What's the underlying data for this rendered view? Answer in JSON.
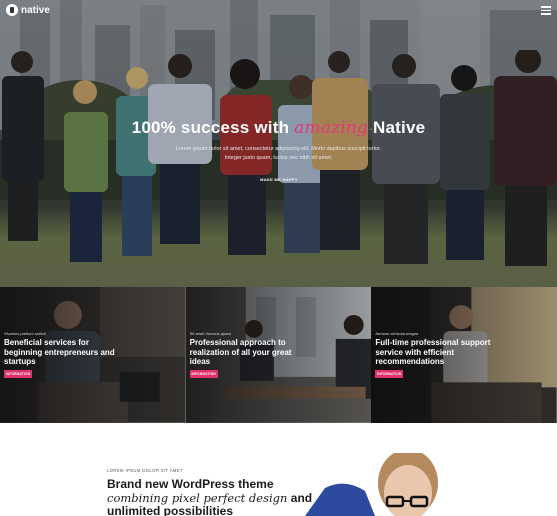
{
  "brand": {
    "logo_text": "native"
  },
  "hero": {
    "title_before": "100% success with",
    "title_accent": "amazing",
    "title_after": "Native",
    "subtitle_line1": "Lorem ipsum dolor sit amet, consectetur adipiscing elit. Morbi dapibus suscipit tortor.",
    "subtitle_line2": "Integer justo quam, luctus nec nibh sit amet.",
    "cta_label": "MAKE ME HAPPY"
  },
  "features": [
    {
      "eyebrow": "Vivamus pretium sollicit",
      "title": "Beneficial services for beginning entrepreneurs and startups",
      "button": "INFORMATION"
    },
    {
      "eyebrow": "Sit amet rhoncus quam",
      "title": "Professional approach to realization of all your great ideas",
      "button": "INFORMATION"
    },
    {
      "eyebrow": "Aenean vehicula magna",
      "title": "Full-time professional support service with efficient recommendations",
      "button": "INFORMATION"
    }
  ],
  "intro": {
    "eyebrow": "LOREM IPSUM DOLOR SIT AMET",
    "title_line1": "Brand new WordPress theme",
    "title_italic": "combining pixel perfect design",
    "title_and": "and",
    "title_line3": "unlimited possibilities"
  },
  "colors": {
    "accent": "#e0306e",
    "hero_dark": "#2f3438"
  },
  "icons": {
    "menu": "hamburger-icon",
    "logo": "native-logo-icon"
  }
}
